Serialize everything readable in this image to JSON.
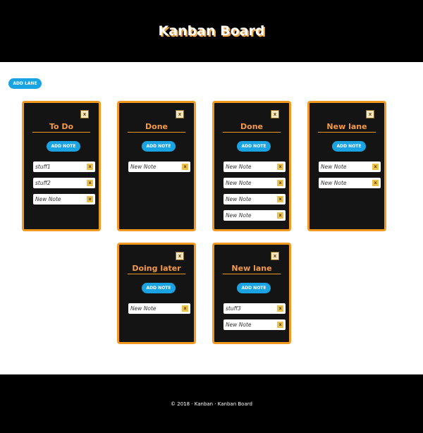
{
  "header": {
    "title": "Kanban Board"
  },
  "toolbar": {
    "add_lane_label": "ADD LANE"
  },
  "lanes": [
    {
      "title": "To Do",
      "close_label": "x",
      "add_note_label": "ADD NOTE",
      "notes": [
        {
          "text": "stuff1",
          "close": "x"
        },
        {
          "text": "stuff2",
          "close": "x"
        },
        {
          "text": "New Note",
          "close": "x"
        }
      ]
    },
    {
      "title": "Done",
      "close_label": "x",
      "add_note_label": "ADD NOTE",
      "notes": [
        {
          "text": "New Note",
          "close": "x"
        }
      ]
    },
    {
      "title": "Done",
      "close_label": "x",
      "add_note_label": "ADD NOTE",
      "notes": [
        {
          "text": "New Note",
          "close": "x"
        },
        {
          "text": "New Note",
          "close": "x"
        },
        {
          "text": "New Note",
          "close": "x"
        },
        {
          "text": "New Note",
          "close": "x"
        }
      ]
    },
    {
      "title": "New lane",
      "close_label": "x",
      "add_note_label": "ADD NOTE",
      "notes": [
        {
          "text": "New Note",
          "close": "x"
        },
        {
          "text": "New Note",
          "close": "x"
        }
      ]
    },
    {
      "title": "Doing later",
      "close_label": "x",
      "add_note_label": "ADD NOTE",
      "notes": [
        {
          "text": "New Note",
          "close": "x"
        }
      ]
    },
    {
      "title": "New lane",
      "close_label": "x",
      "add_note_label": "ADD NOTE",
      "notes": [
        {
          "text": "stuff3",
          "close": "x"
        },
        {
          "text": "New Note",
          "close": "x"
        }
      ]
    }
  ],
  "footer": {
    "text": "© 2018 · Kanban · Kanban Board"
  },
  "colors": {
    "accent": "#f09a21",
    "button": "#1aa3e2",
    "lane_bg": "#141414",
    "title": "#f39a4a"
  }
}
